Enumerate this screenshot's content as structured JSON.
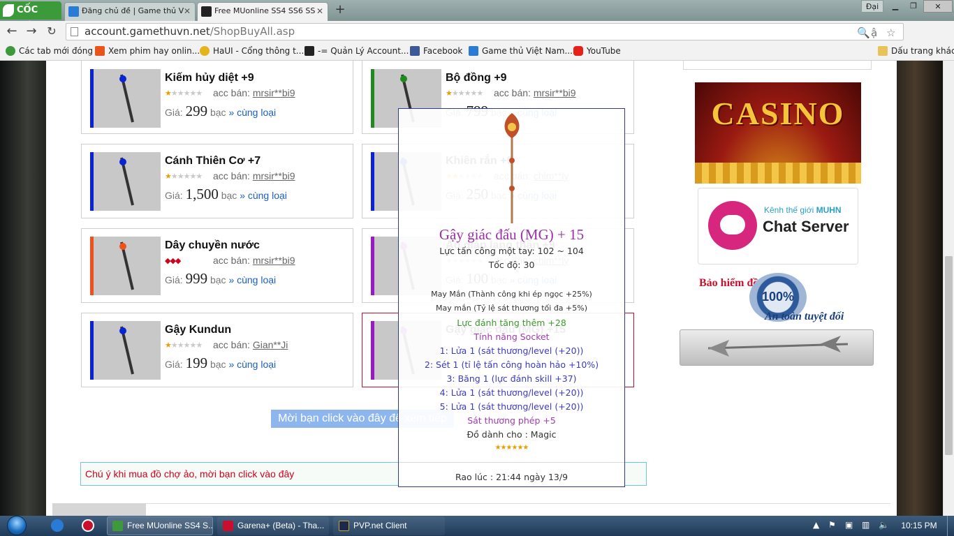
{
  "browser": {
    "brand": "CỐC CỐC",
    "tabs": [
      {
        "title": "Đăng chủ đề | Game thủ V",
        "active": false
      },
      {
        "title": "Free MUonline SS4 SS6 SS",
        "active": true
      }
    ],
    "profile": "Đại",
    "url_host": "account.gamethuvn.net",
    "url_path": "/ShopBuyAll.asp",
    "bookmarks": [
      "Các tab mới đóng",
      "Xem phim hay onlin...",
      "HaUI - Cổng thông t...",
      "-= Quản Lý Account...",
      "Facebook",
      "Game thủ Việt Nam...",
      "YouTube"
    ],
    "other_bookmarks": "Dấu trang khác"
  },
  "items": [
    {
      "name": "Kiếm hủy diệt +9",
      "stars_on": 1,
      "stars_total": 6,
      "seller_label": "acc bán:",
      "seller": "mrsir**bi9",
      "price_label": "Giá:",
      "price": "299",
      "currency": "bạc",
      "same": "» cùng loại",
      "bar_color": "#0a23d6"
    },
    {
      "name": "Bộ đồng +9",
      "stars_on": 1,
      "stars_total": 6,
      "seller_label": "acc bán:",
      "seller": "mrsir**bi9",
      "price_label": "Giá:",
      "price": "799",
      "currency": "bạc",
      "same": "» cùng loại",
      "bar_color": "#1f8a1f"
    },
    {
      "name": "Cánh Thiên Cơ +7",
      "stars_on": 1,
      "stars_total": 6,
      "seller_label": "acc bán:",
      "seller": "mrsir**bi9",
      "price_label": "Giá:",
      "price": "1,500",
      "currency": "bạc",
      "same": "» cùng loại",
      "bar_color": "#0a23d6"
    },
    {
      "name": "Khiên rắn +9",
      "stars_on": 2,
      "stars_total": 6,
      "seller_label": "acc bán:",
      "seller": "chim**ly",
      "price_label": "Giá:",
      "price": "250",
      "currency": "bạc",
      "same": "» cùng loại",
      "bar_color": "#0a23d6"
    },
    {
      "name": "Dây chuyền nước",
      "stars_on": 0,
      "stars_total": 0,
      "red_marks": "◆◆◆",
      "seller_label": "acc bán:",
      "seller": "mrsir**bi9",
      "price_label": "Giá:",
      "price": "999",
      "currency": "bạc",
      "same": "» cùng loại",
      "bar_color": "#f0501e"
    },
    {
      "name": "Áo giáp lang thần +9",
      "stars_on": 0,
      "stars_total": 6,
      "seller_label": "acc bán:",
      "seller": "chim**ly",
      "price_label": "Giá:",
      "price": "100",
      "currency": "bạc",
      "same": "» cùng loại",
      "bar_color": "#9b19c4"
    },
    {
      "name": "Gậy Kundun",
      "stars_on": 1,
      "stars_total": 6,
      "seller_label": "acc bán:",
      "seller": "Gian**Ji",
      "price_label": "Giá:",
      "price": "199",
      "currency": "bạc",
      "same": "» cùng loại",
      "bar_color": "#0a23d6"
    },
    {
      "name": "Gậy giác đấu (MG) +15",
      "stars_on": 0,
      "stars_total": 0,
      "seller_label": "",
      "seller": "",
      "price_label": "",
      "price": "",
      "currency": "",
      "same": "",
      "bar_color": "#9b19c4"
    }
  ],
  "more_button": "Mời bạn click vào đây để xem tiếp",
  "notice": "Chú ý khi mua đồ chợ ảo, mời bạn click vào đây",
  "ads": {
    "casino": "CASINO",
    "chat_line1": "Kênh thế giới",
    "chat_line1_brand": "MUHN",
    "chat_line2": "Chat Server",
    "insure_title": "Bảo hiểm đồ",
    "insure_seal": "100%",
    "insure_tag": "An toàn tuyệt đối"
  },
  "tooltip": {
    "name": "Gậy giác đấu (MG) + 15",
    "attack": "Lực tấn công một tay: 102 ~ 104",
    "speed": "Tốc độ: 30",
    "luck1": "May Mắn (Thành công khi ép ngọc +25%)",
    "luck2": "May mắn (Tỷ lệ sát thương tối đa +5%)",
    "extra": "Lực đánh tăng thêm +28",
    "socket_title": "Tính năng Socket",
    "sockets": [
      "1: Lửa 1 (sát thương/level (+20))",
      "2: Sét 1 (tỉ lệ tấn công hoàn hảo +10%)",
      "3: Băng 1 (lực đánh skill +37)",
      "4: Lửa 1 (sát thương/level (+20))",
      "5: Lửa 1 (sát thương/level (+20))"
    ],
    "magic": "Sát thương phép +5",
    "class": "Đồ dành cho : Magic",
    "stars": "★★★★★★",
    "posted": "Rao lúc : 21:44 ngày 13/9"
  },
  "taskbar": {
    "items": [
      "Free MUonline SS4 S...",
      "Garena+ (Beta) - Tha...",
      "PVP.net Client"
    ],
    "clock": "10:15 PM"
  }
}
